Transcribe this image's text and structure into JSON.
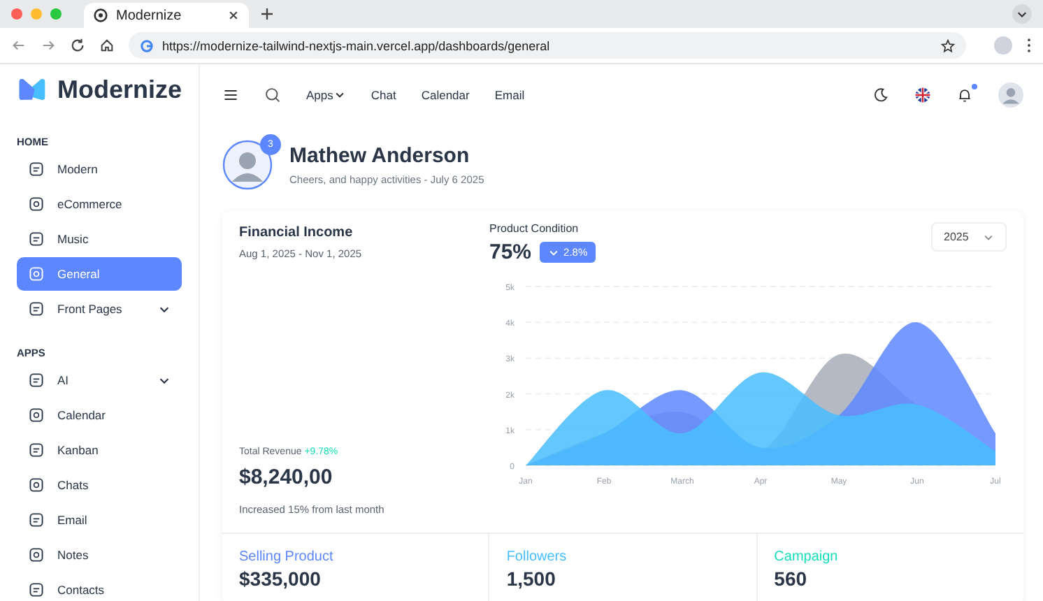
{
  "browser": {
    "tab_title": "Modernize",
    "url": "https://modernize-tailwind-nextjs-main.vercel.app/dashboards/general"
  },
  "sidebar": {
    "logo": "Modernize",
    "sections": [
      {
        "title": "HOME",
        "items": [
          {
            "label": "Modern",
            "selected": false,
            "has_submenu": false
          },
          {
            "label": "eCommerce",
            "selected": false,
            "has_submenu": false
          },
          {
            "label": "Music",
            "selected": false,
            "has_submenu": false
          },
          {
            "label": "General",
            "selected": true,
            "has_submenu": false
          },
          {
            "label": "Front Pages",
            "selected": false,
            "has_submenu": true
          }
        ]
      },
      {
        "title": "APPS",
        "items": [
          {
            "label": "AI",
            "selected": false,
            "has_submenu": true
          },
          {
            "label": "Calendar",
            "selected": false,
            "has_submenu": false
          },
          {
            "label": "Kanban",
            "selected": false,
            "has_submenu": false
          },
          {
            "label": "Chats",
            "selected": false,
            "has_submenu": false
          },
          {
            "label": "Email",
            "selected": false,
            "has_submenu": false
          },
          {
            "label": "Notes",
            "selected": false,
            "has_submenu": false
          },
          {
            "label": "Contacts",
            "selected": false,
            "has_submenu": false
          }
        ]
      }
    ]
  },
  "header": {
    "nav": [
      {
        "label": "Apps",
        "has_dropdown": true
      },
      {
        "label": "Chat",
        "has_dropdown": false
      },
      {
        "label": "Calendar",
        "has_dropdown": false
      },
      {
        "label": "Email",
        "has_dropdown": false
      }
    ],
    "notification_dot": true
  },
  "profile": {
    "badge": "3",
    "name": "Mathew Anderson",
    "subtitle": "Cheers, and happy activities - July 6 2025"
  },
  "income": {
    "title": "Financial Income",
    "date_range": "Aug 1, 2025 - Nov 1, 2025",
    "revenue_label": "Total Revenue",
    "revenue_change": "+9.78%",
    "revenue": "$8,240,00",
    "note": "Increased 15% from last month"
  },
  "condition": {
    "title": "Product Condition",
    "value": "75%",
    "change": "2.8%",
    "year": "2025",
    "chart_data": {
      "type": "area",
      "categories": [
        "Jan",
        "Feb",
        "March",
        "Apr",
        "May",
        "Jun",
        "Jul"
      ],
      "yticks": [
        {
          "value": 0,
          "label": "0"
        },
        {
          "value": 1000,
          "label": "1k"
        },
        {
          "value": 2000,
          "label": "2k"
        },
        {
          "value": 3000,
          "label": "3k"
        },
        {
          "value": 4000,
          "label": "4k"
        },
        {
          "value": 5000,
          "label": "5k"
        }
      ],
      "ylim": [
        0,
        5000
      ],
      "grid": true,
      "series": [
        {
          "color": "#a8adb8",
          "values": [
            0,
            900,
            1500,
            400,
            3100,
            1700,
            400
          ]
        },
        {
          "color": "#5d87ff",
          "values": [
            0,
            900,
            2100,
            500,
            1400,
            4000,
            900
          ]
        },
        {
          "color": "#49beff",
          "values": [
            0,
            2100,
            900,
            2600,
            1400,
            1700,
            400
          ]
        }
      ]
    }
  },
  "stats": [
    {
      "label": "Selling Product",
      "value": "$335,000",
      "color": "#5d87ff"
    },
    {
      "label": "Followers",
      "value": "1,500",
      "color": "#49beff"
    },
    {
      "label": "Campaign",
      "value": "560",
      "color": "#13deb9"
    }
  ]
}
